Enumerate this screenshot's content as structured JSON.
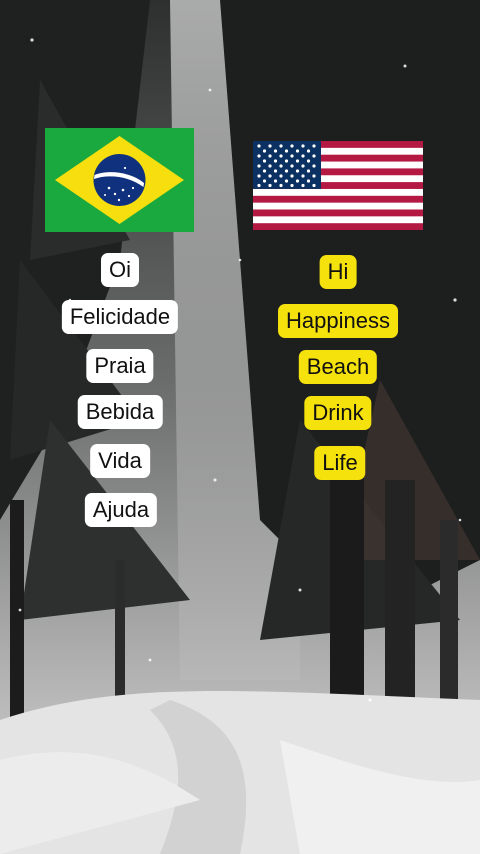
{
  "flags": {
    "left": {
      "icon": "brazil-flag-icon",
      "colors": {
        "green": "#1aa93e",
        "yellow": "#f7de0e",
        "blue": "#10317e"
      }
    },
    "right": {
      "icon": "usa-flag-icon",
      "colors": {
        "red": "#b31942",
        "white": "#ffffff",
        "blue": "#0a3161"
      }
    }
  },
  "portuguese_words": [
    "Oi",
    "Felicidade",
    "Praia",
    "Bebida",
    "Vida",
    "Ajuda"
  ],
  "english_words": [
    "Hi",
    "Happiness",
    "Beach",
    "Drink",
    "Life"
  ],
  "colors": {
    "pt_label_bg": "#ffffff",
    "en_label_bg": "#f5e10c"
  }
}
